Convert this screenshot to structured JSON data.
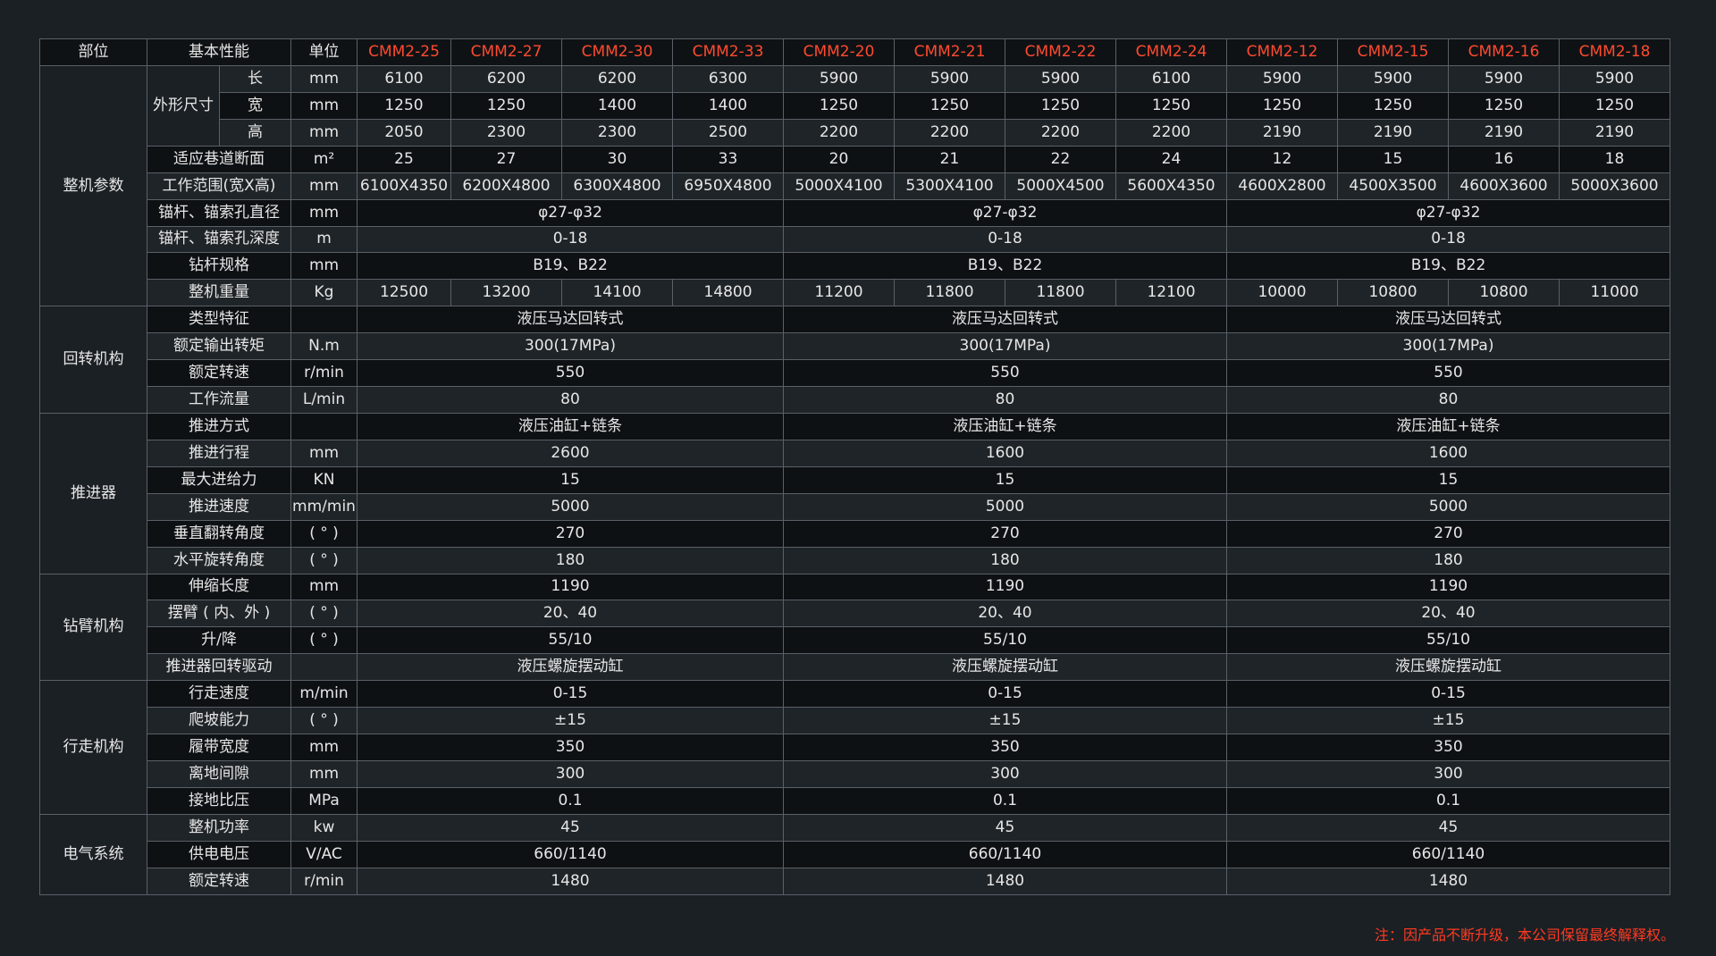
{
  "header": {
    "part": "部位",
    "basic": "基本性能",
    "unit": "单位",
    "models": [
      "CMM2-25",
      "CMM2-27",
      "CMM2-30",
      "CMM2-33",
      "CMM2-20",
      "CMM2-21",
      "CMM2-22",
      "CMM2-24",
      "CMM2-12",
      "CMM2-15",
      "CMM2-16",
      "CMM2-18"
    ]
  },
  "sections": [
    {
      "name": "整机参数",
      "rows": [
        {
          "sub": "外形尺寸",
          "label": "长",
          "unit": "mm",
          "cells": [
            "6100",
            "6200",
            "6200",
            "6300",
            "5900",
            "5900",
            "5900",
            "6100",
            "5900",
            "5900",
            "5900",
            "5900"
          ]
        },
        {
          "label": "宽",
          "unit": "mm",
          "cells": [
            "1250",
            "1250",
            "1400",
            "1400",
            "1250",
            "1250",
            "1250",
            "1250",
            "1250",
            "1250",
            "1250",
            "1250"
          ]
        },
        {
          "label": "高",
          "unit": "mm",
          "cells": [
            "2050",
            "2300",
            "2300",
            "2500",
            "2200",
            "2200",
            "2200",
            "2200",
            "2190",
            "2190",
            "2190",
            "2190"
          ]
        },
        {
          "label": "适应巷道断面",
          "unit": "m²",
          "cells": [
            "25",
            "27",
            "30",
            "33",
            "20",
            "21",
            "22",
            "24",
            "12",
            "15",
            "16",
            "18"
          ]
        },
        {
          "label": "工作范围(宽X高)",
          "unit": "mm",
          "cells": [
            "6100X4350",
            "6200X4800",
            "6300X4800",
            "6950X4800",
            "5000X4100",
            "5300X4100",
            "5000X4500",
            "5600X4350",
            "4600X2800",
            "4500X3500",
            "4600X3600",
            "5000X3600"
          ]
        },
        {
          "label": "锚杆、锚索孔直径",
          "unit": "mm",
          "cells": [
            "φ27-φ32",
            "φ27-φ32",
            "φ27-φ32"
          ]
        },
        {
          "label": "锚杆、锚索孔深度",
          "unit": "m",
          "cells": [
            "0-18",
            "0-18",
            "0-18"
          ]
        },
        {
          "label": "钻杆规格",
          "unit": "mm",
          "cells": [
            "B19、B22",
            "B19、B22",
            "B19、B22"
          ]
        },
        {
          "label": "整机重量",
          "unit": "Kg",
          "cells": [
            "12500",
            "13200",
            "14100",
            "14800",
            "11200",
            "11800",
            "11800",
            "12100",
            "10000",
            "10800",
            "10800",
            "11000"
          ]
        }
      ]
    },
    {
      "name": "回转机构",
      "rows": [
        {
          "label": "类型特征",
          "unit": "",
          "cells": [
            "液压马达回转式",
            "液压马达回转式",
            "液压马达回转式"
          ]
        },
        {
          "label": "额定输出转矩",
          "unit": "N.m",
          "cells": [
            "300(17MPa)",
            "300(17MPa)",
            "300(17MPa)"
          ]
        },
        {
          "label": "额定转速",
          "unit": "r/min",
          "cells": [
            "550",
            "550",
            "550"
          ]
        },
        {
          "label": "工作流量",
          "unit": "L/min",
          "cells": [
            "80",
            "80",
            "80"
          ]
        }
      ]
    },
    {
      "name": "推进器",
      "rows": [
        {
          "label": "推进方式",
          "unit": "",
          "cells": [
            "液压油缸+链条",
            "液压油缸+链条",
            "液压油缸+链条"
          ]
        },
        {
          "label": "推进行程",
          "unit": "mm",
          "cells": [
            "2600",
            "1600",
            "1600"
          ]
        },
        {
          "label": "最大进给力",
          "unit": "KN",
          "cells": [
            "15",
            "15",
            "15"
          ]
        },
        {
          "label": "推进速度",
          "unit": "mm/min",
          "cells": [
            "5000",
            "5000",
            "5000"
          ]
        },
        {
          "label": "垂直翻转角度",
          "unit": "( ° )",
          "cells": [
            "270",
            "270",
            "270"
          ]
        },
        {
          "label": "水平旋转角度",
          "unit": "( ° )",
          "cells": [
            "180",
            "180",
            "180"
          ]
        }
      ]
    },
    {
      "name": "钻臂机构",
      "rows": [
        {
          "label": "伸缩长度",
          "unit": "mm",
          "cells": [
            "1190",
            "1190",
            "1190"
          ]
        },
        {
          "label": "摆臂 ( 内、外 )",
          "unit": "( ° )",
          "cells": [
            "20、40",
            "20、40",
            "20、40"
          ]
        },
        {
          "label": "升/降",
          "unit": "( ° )",
          "cells": [
            "55/10",
            "55/10",
            "55/10"
          ]
        },
        {
          "label": "推进器回转驱动",
          "unit": "",
          "cells": [
            "液压螺旋摆动缸",
            "液压螺旋摆动缸",
            "液压螺旋摆动缸"
          ]
        }
      ]
    },
    {
      "name": "行走机构",
      "rows": [
        {
          "label": "行走速度",
          "unit": "m/min",
          "cells": [
            "0-15",
            "0-15",
            "0-15"
          ]
        },
        {
          "label": "爬坡能力",
          "unit": "( ° )",
          "cells": [
            "±15",
            "±15",
            "±15"
          ]
        },
        {
          "label": "履带宽度",
          "unit": "mm",
          "cells": [
            "350",
            "350",
            "350"
          ]
        },
        {
          "label": "离地间隙",
          "unit": "mm",
          "cells": [
            "300",
            "300",
            "300"
          ]
        },
        {
          "label": "接地比压",
          "unit": "MPa",
          "cells": [
            "0.1",
            "0.1",
            "0.1"
          ]
        }
      ]
    },
    {
      "name": "电气系统",
      "rows": [
        {
          "label": "整机功率",
          "unit": "kw",
          "cells": [
            "45",
            "45",
            "45"
          ]
        },
        {
          "label": "供电电压",
          "unit": "V/AC",
          "cells": [
            "660/1140",
            "660/1140",
            "660/1140"
          ]
        },
        {
          "label": "额定转速",
          "unit": "r/min",
          "cells": [
            "1480",
            "1480",
            "1480"
          ]
        }
      ]
    }
  ],
  "note": "注：因产品不断升级，本公司保留最终解释权。"
}
